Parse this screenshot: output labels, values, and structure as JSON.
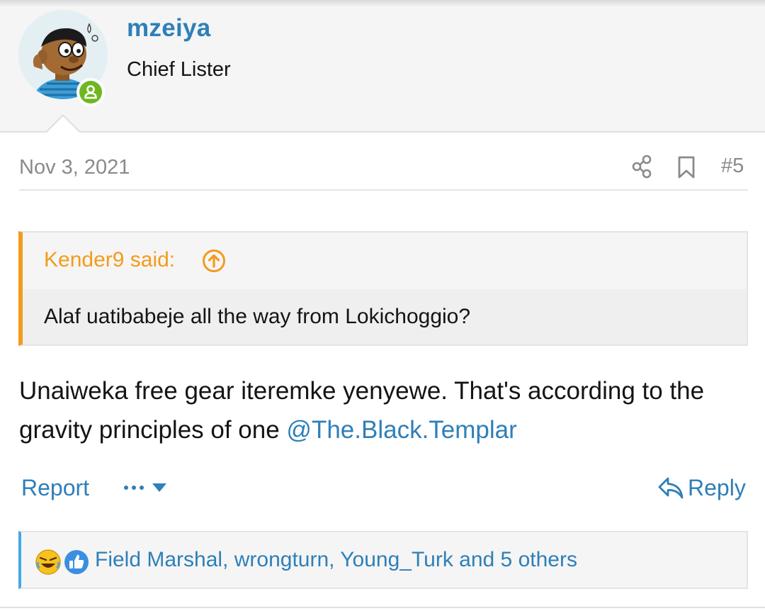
{
  "author": {
    "username": "mzeiya",
    "user_title": "Chief Lister",
    "online": true
  },
  "post": {
    "date": "Nov 3, 2021",
    "number": "#5",
    "quote": {
      "title": "Kender9 said:",
      "text": "Alaf uatibabeje all the way from Lokichoggio?"
    },
    "body_text": "Unaiweka free gear iteremke yenyewe. That's according to the gravity principles of one ",
    "mention": "@The.Black.Templar"
  },
  "actions": {
    "report_label": "Report",
    "reply_label": "Reply"
  },
  "reactions": {
    "summary": "Field Marshal, wrongturn, Young_Turk and 5 others",
    "types": [
      "laugh",
      "like"
    ]
  },
  "colors": {
    "link": "#2f7fb8",
    "quote_accent": "#f39b1c",
    "reactions_accent": "#47a7eb",
    "online": "#6fb721"
  },
  "icons": [
    "share-icon",
    "bookmark-icon",
    "quote-jump-icon",
    "more-icon",
    "reply-icon",
    "laugh-reaction-icon",
    "like-reaction-icon"
  ]
}
